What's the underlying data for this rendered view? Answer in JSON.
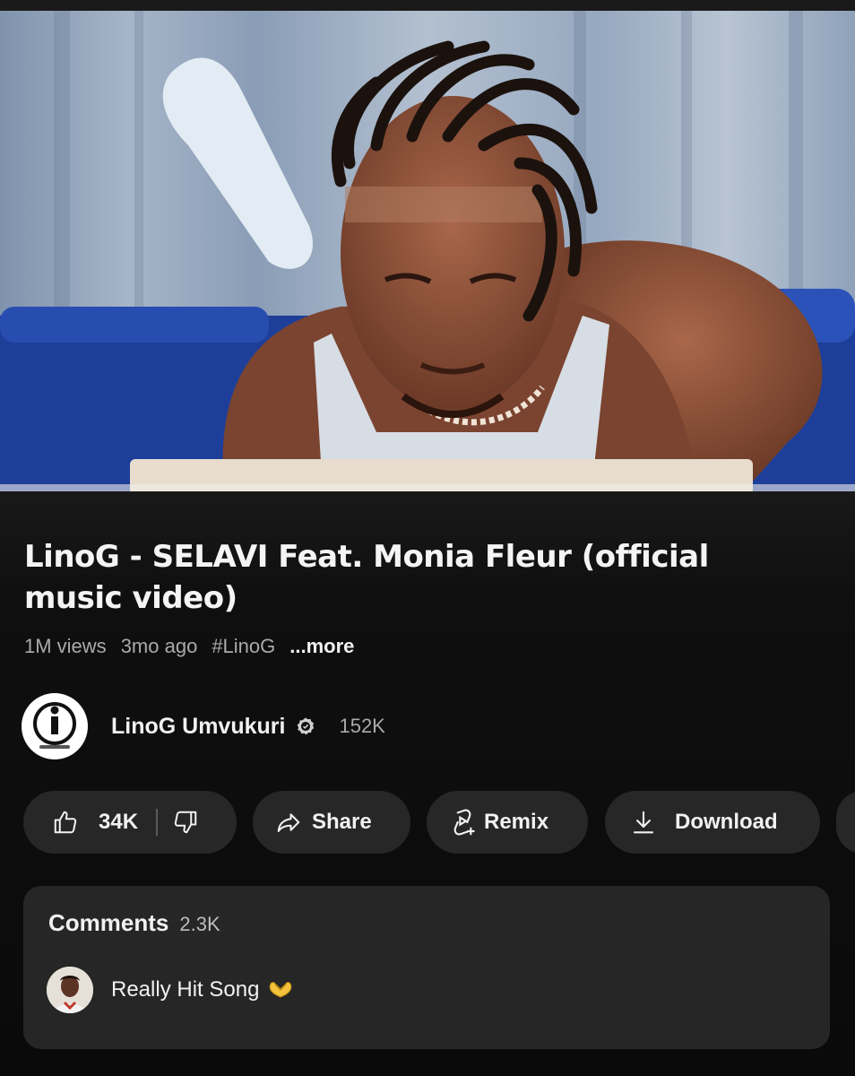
{
  "video": {
    "title": "LinoG - SELAVI Feat. Monia Fleur (official music video)",
    "views": "1M views",
    "age": "3mo ago",
    "hashtag": "#LinoG",
    "more_label": "...more"
  },
  "channel": {
    "name": "LinoG Umvukuri",
    "subscribers": "152K",
    "avatar_icon": "umvukuri-logo-icon",
    "verified_icon": "verified-badge-icon"
  },
  "actions": {
    "like_count": "34K",
    "like_icon": "thumbs-up-icon",
    "dislike_icon": "thumbs-down-icon",
    "share_label": "Share",
    "share_icon": "share-arrow-icon",
    "remix_label": "Remix",
    "remix_icon": "remix-icon",
    "download_label": "Download",
    "download_icon": "download-icon"
  },
  "comments": {
    "title": "Comments",
    "count": "2.3K",
    "top_comment": {
      "text": "Really Hit Song",
      "emoji": "🫶"
    }
  },
  "colors": {
    "background": "#0f0f0f",
    "pill": "#272727",
    "card": "#262626",
    "text": "#f1f1f1",
    "secondary_text": "#aaaaaa"
  }
}
